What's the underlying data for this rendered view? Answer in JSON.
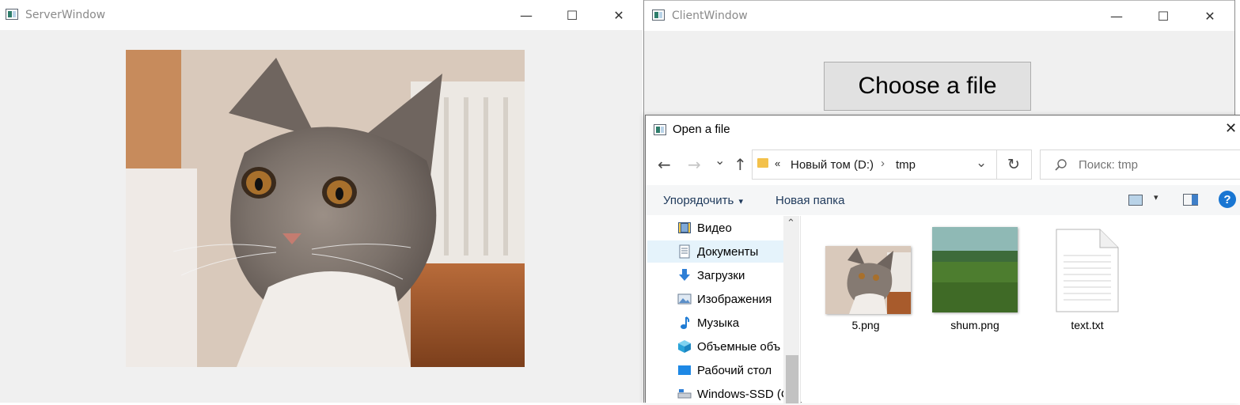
{
  "server_window": {
    "title": "ServerWindow",
    "controls": {
      "minimize": "—",
      "maximize": "☐",
      "close": "✕"
    }
  },
  "client_window": {
    "title": "ClientWindow",
    "controls": {
      "minimize": "—",
      "maximize": "☐",
      "close": "✕"
    },
    "choose_button_label": "Choose a file"
  },
  "dialog": {
    "title": "Open a file",
    "close": "✕",
    "nav": {
      "back": "←",
      "forward": "→",
      "recent": "⌄",
      "up": "↑"
    },
    "address": {
      "overflow": "«",
      "segments": [
        "Новый том (D:)",
        "tmp"
      ],
      "separator": "›",
      "dropdown": "⌄",
      "refresh": "↻"
    },
    "search": {
      "placeholder": "Поиск: tmp",
      "icon": "search-icon"
    },
    "toolbar": {
      "organize_label": "Упорядочить",
      "organize_arrow": "▾",
      "new_folder_label": "Новая папка",
      "view_arrow": "▾",
      "help": "?"
    },
    "nav_pane": {
      "scroll_up": "⌃",
      "items": [
        {
          "label": "Видео",
          "icon": "video-icon"
        },
        {
          "label": "Документы",
          "icon": "documents-icon",
          "selected": true
        },
        {
          "label": "Загрузки",
          "icon": "downloads-icon"
        },
        {
          "label": "Изображения",
          "icon": "pictures-icon"
        },
        {
          "label": "Музыка",
          "icon": "music-icon"
        },
        {
          "label": "Объемные объ",
          "icon": "3d-objects-icon"
        },
        {
          "label": "Рабочий стол",
          "icon": "desktop-icon"
        },
        {
          "label": "Windows-SSD (C",
          "icon": "drive-icon"
        }
      ]
    },
    "files": [
      {
        "name": "5.png",
        "type": "image-cat"
      },
      {
        "name": "shum.png",
        "type": "image-landscape"
      },
      {
        "name": "text.txt",
        "type": "text-document"
      }
    ]
  },
  "colors": {
    "window_bg": "#f0f0f0",
    "button_bg": "#e1e1e1",
    "selection": "#e5f3fb",
    "help_blue": "#1976d2",
    "folder_yellow": "#f3c14b"
  }
}
